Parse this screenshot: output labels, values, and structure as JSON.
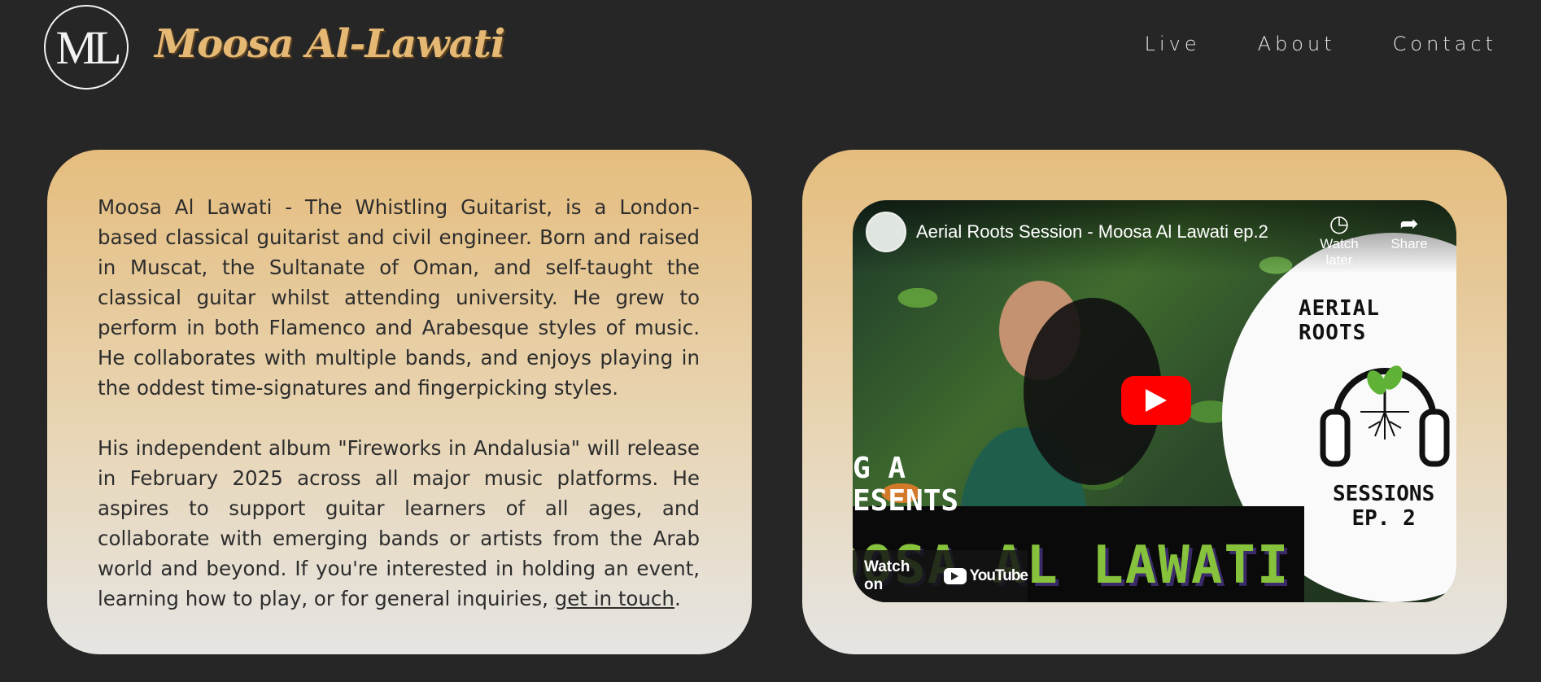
{
  "header": {
    "logo_monogram": "ML",
    "brand_name": "Moosa Al-Lawati",
    "nav": [
      {
        "label": "Live"
      },
      {
        "label": "About"
      },
      {
        "label": "Contact"
      }
    ]
  },
  "about": {
    "paragraph1": "Moosa Al Lawati - The Whistling Guitarist, is a London-based classical guitarist and civil engineer. Born and raised in Muscat, the Sultanate of Oman, and self-taught the classical guitar whilst attending university. He grew to perform in both Flamenco and Arabesque styles of music. He collaborates with multiple bands, and enjoys playing in the oddest time-signatures and fingerpicking styles.",
    "paragraph2_pre": "His independent album \"Fireworks in Andalusia\" will release in February 2025 across all major music platforms. He aspires to support guitar learners of all ages, and collaborate with emerging bands or artists from the Arab world and beyond. If you're interested in holding an event, learning how to play, or for general inquiries, ",
    "contact_link": "get in touch",
    "paragraph2_post": "."
  },
  "video": {
    "title": "Aerial Roots Session - Moosa Al Lawati ep.2",
    "watch_later": "Watch later",
    "share": "Share",
    "watch_on": "Watch on",
    "youtube": "YouTube",
    "thumbnail": {
      "series_title": "AERIAL ROOTS",
      "sessions": "SESSIONS",
      "episode": "EP. 2",
      "presents_line1": "G A",
      "presents_line2": "ESENTS",
      "name": "OOSA AL LAWATI"
    }
  },
  "colors": {
    "background": "#262626",
    "accent": "#e5b874",
    "card_top": "#e5bd7e",
    "card_bottom": "#e6e5e3",
    "youtube_red": "#ff0000"
  }
}
